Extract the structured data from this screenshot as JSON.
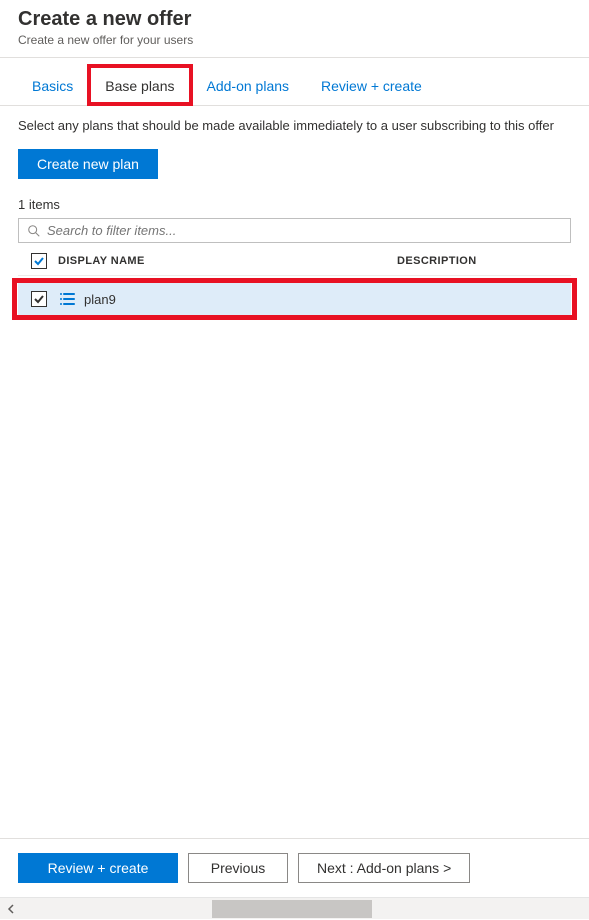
{
  "header": {
    "title": "Create a new offer",
    "subtitle": "Create a new offer for your users"
  },
  "tabs": [
    {
      "label": "Basics",
      "active": false
    },
    {
      "label": "Base plans",
      "active": true
    },
    {
      "label": "Add-on plans",
      "active": false
    },
    {
      "label": "Review + create",
      "active": false
    }
  ],
  "description": "Select any plans that should be made available immediately to a user subscribing to this offer",
  "buttons": {
    "create_new_plan": "Create new plan",
    "review_create": "Review + create",
    "previous": "Previous",
    "next": "Next : Add-on plans >"
  },
  "items_count_label": "1 items",
  "search": {
    "placeholder": "Search to filter items..."
  },
  "columns": {
    "display_name": "DISPLAY NAME",
    "description": "DESCRIPTION"
  },
  "rows": [
    {
      "name": "plan9",
      "description": "",
      "checked": true
    }
  ]
}
